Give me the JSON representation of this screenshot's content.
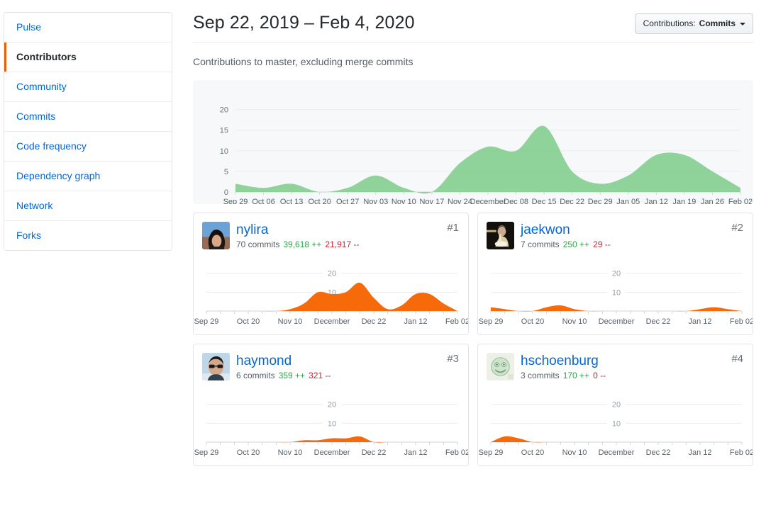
{
  "sidebar": {
    "items": [
      {
        "label": "Pulse",
        "active": false
      },
      {
        "label": "Contributors",
        "active": true
      },
      {
        "label": "Community",
        "active": false
      },
      {
        "label": "Commits",
        "active": false
      },
      {
        "label": "Code frequency",
        "active": false
      },
      {
        "label": "Dependency graph",
        "active": false
      },
      {
        "label": "Network",
        "active": false
      },
      {
        "label": "Forks",
        "active": false
      }
    ]
  },
  "header": {
    "title": "Sep 22, 2019 – Feb 4, 2020",
    "dropdown_prefix": "Contributions:",
    "dropdown_value": "Commits",
    "dropdown_caret": "chevron-down-icon",
    "subtitle": "Contributions to master, excluding merge commits"
  },
  "colors": {
    "green_fill": "#6cc644",
    "green_area": "#7dcb88",
    "orange_area": "#f66a0a",
    "link_blue": "#0366d6",
    "accent_orange": "#e36209",
    "additions": "#28a745",
    "deletions": "#cb2431",
    "panel_bg": "#f6f8fa",
    "border": "#e1e4e8"
  },
  "chart_data": [
    {
      "id": "overall-commits-chart",
      "type": "area",
      "title": "Contributions to master, excluding merge commits",
      "xlabel": "",
      "ylabel": "",
      "ylim": [
        0,
        22
      ],
      "yticks": [
        0,
        5,
        10,
        15,
        20
      ],
      "grid": true,
      "legend": "none",
      "color": "#7dcb88",
      "categories": [
        "Sep 29",
        "Oct 06",
        "Oct 13",
        "Oct 20",
        "Oct 27",
        "Nov 03",
        "Nov 10",
        "Nov 17",
        "Nov 24",
        "December",
        "Dec 08",
        "Dec 15",
        "Dec 22",
        "Dec 29",
        "Jan 05",
        "Jan 12",
        "Jan 19",
        "Jan 26",
        "Feb 02"
      ],
      "values": [
        2,
        1,
        2,
        0,
        1,
        4,
        1,
        0,
        7,
        11,
        10,
        16,
        5,
        2,
        4,
        9,
        9,
        5,
        1
      ]
    },
    {
      "id": "nylira-chart",
      "type": "area",
      "color": "#f66a0a",
      "ylim": [
        0,
        24
      ],
      "yticks": [
        10,
        20
      ],
      "categories": [
        "Sep 29",
        "Oct 20",
        "Nov 10",
        "December",
        "Dec 22",
        "Jan 12",
        "Feb 02"
      ],
      "x_all": [
        "Sep 29",
        "Oct 06",
        "Oct 13",
        "Oct 20",
        "Oct 27",
        "Nov 03",
        "Nov 10",
        "Nov 17",
        "Nov 24",
        "December",
        "Dec 08",
        "Dec 15",
        "Dec 22",
        "Dec 29",
        "Jan 05",
        "Jan 12",
        "Jan 19",
        "Jan 26",
        "Feb 02"
      ],
      "values": [
        0,
        0,
        0,
        0,
        0,
        0,
        1,
        4,
        10,
        9,
        10,
        15,
        7,
        1,
        3,
        9,
        9,
        4,
        0
      ]
    },
    {
      "id": "jaekwon-chart",
      "type": "area",
      "color": "#f66a0a",
      "ylim": [
        0,
        24
      ],
      "yticks": [
        10,
        20
      ],
      "categories": [
        "Sep 29",
        "Oct 20",
        "Nov 10",
        "December",
        "Dec 22",
        "Jan 12",
        "Feb 02"
      ],
      "x_all": [
        "Sep 29",
        "Oct 06",
        "Oct 13",
        "Oct 20",
        "Oct 27",
        "Nov 03",
        "Nov 10",
        "Nov 17",
        "Nov 24",
        "December",
        "Dec 08",
        "Dec 15",
        "Dec 22",
        "Dec 29",
        "Jan 05",
        "Jan 12",
        "Jan 19",
        "Jan 26",
        "Feb 02"
      ],
      "values": [
        2,
        1,
        0,
        0,
        2,
        3,
        1,
        0,
        0,
        0,
        0,
        0,
        0,
        0,
        0,
        1,
        2,
        1,
        0
      ]
    },
    {
      "id": "haymond-chart",
      "type": "area",
      "color": "#f66a0a",
      "ylim": [
        0,
        24
      ],
      "yticks": [
        10,
        20
      ],
      "categories": [
        "Sep 29",
        "Oct 20",
        "Nov 10",
        "December",
        "Dec 22",
        "Jan 12",
        "Feb 02"
      ],
      "x_all": [
        "Sep 29",
        "Oct 06",
        "Oct 13",
        "Oct 20",
        "Oct 27",
        "Nov 03",
        "Nov 10",
        "Nov 17",
        "Nov 24",
        "December",
        "Dec 08",
        "Dec 15",
        "Dec 22",
        "Dec 29",
        "Jan 05",
        "Jan 12",
        "Jan 19",
        "Jan 26",
        "Feb 02"
      ],
      "values": [
        0,
        0,
        0,
        0,
        0,
        0,
        0,
        1,
        1,
        2,
        2,
        3,
        0,
        0,
        0,
        0,
        0,
        0,
        0
      ]
    },
    {
      "id": "hschoenburg-chart",
      "type": "area",
      "color": "#f66a0a",
      "ylim": [
        0,
        24
      ],
      "yticks": [
        10,
        20
      ],
      "categories": [
        "Sep 29",
        "Oct 20",
        "Nov 10",
        "December",
        "Dec 22",
        "Jan 12",
        "Feb 02"
      ],
      "x_all": [
        "Sep 29",
        "Oct 06",
        "Oct 13",
        "Oct 20",
        "Oct 27",
        "Nov 03",
        "Nov 10",
        "Nov 17",
        "Nov 24",
        "December",
        "Dec 08",
        "Dec 15",
        "Dec 22",
        "Dec 29",
        "Jan 05",
        "Jan 12",
        "Jan 19",
        "Jan 26",
        "Feb 02"
      ],
      "values": [
        0,
        3,
        2,
        0,
        0,
        0,
        0,
        0,
        0,
        0,
        0,
        0,
        0,
        0,
        0,
        0,
        0,
        0,
        0
      ]
    }
  ],
  "contributors": [
    {
      "rank": "#1",
      "name": "nylira",
      "commits": "70 commits",
      "additions": "39,618 ++",
      "deletions": "21,917 --",
      "avatar": "avatar-photo-nylira",
      "chart_xlabels": [
        "Sep 29",
        "Oct 20",
        "Nov 10",
        "December",
        "Dec 22",
        "Jan 12",
        "Feb 02"
      ],
      "chart_ylabels": [
        "20",
        "10"
      ]
    },
    {
      "rank": "#2",
      "name": "jaekwon",
      "commits": "7 commits",
      "additions": "250 ++",
      "deletions": "29 --",
      "avatar": "avatar-photo-jaekwon",
      "chart_xlabels": [
        "Sep 29",
        "Oct 20",
        "Nov 10",
        "December",
        "Dec 22",
        "Jan 12",
        "Feb 02"
      ],
      "chart_ylabels": [
        "20",
        "10"
      ]
    },
    {
      "rank": "#3",
      "name": "haymond",
      "commits": "6 commits",
      "additions": "359 ++",
      "deletions": "321 --",
      "avatar": "avatar-photo-haymond",
      "chart_xlabels": [
        "Sep 29",
        "Oct 20",
        "Nov 10",
        "December",
        "Dec 22",
        "Jan 12",
        "Feb 02"
      ],
      "chart_ylabels": [
        "20",
        "10"
      ]
    },
    {
      "rank": "#4",
      "name": "hschoenburg",
      "commits": "3 commits",
      "additions": "170 ++",
      "deletions": "0 --",
      "avatar": "avatar-smiley-hschoenburg",
      "chart_xlabels": [
        "Sep 29",
        "Oct 20",
        "Nov 10",
        "December",
        "Dec 22",
        "Jan 12",
        "Feb 02"
      ],
      "chart_ylabels": [
        "20",
        "10"
      ]
    }
  ]
}
